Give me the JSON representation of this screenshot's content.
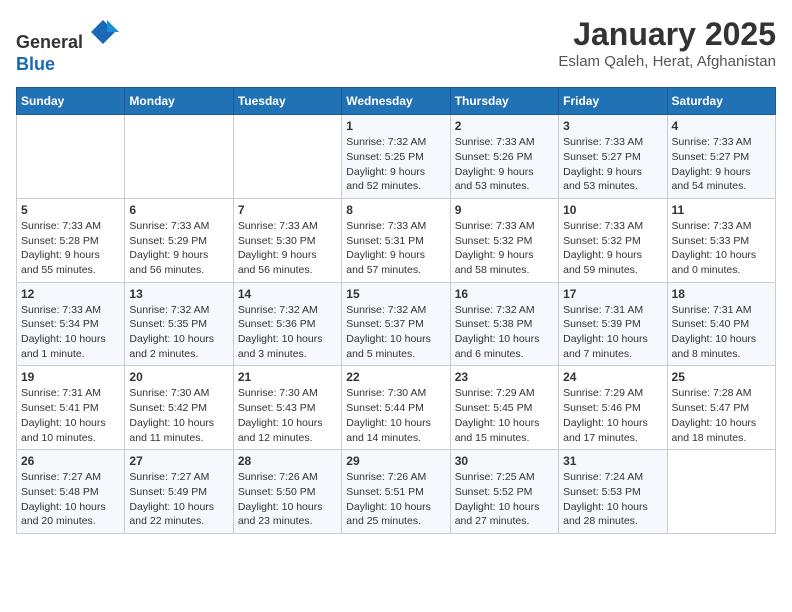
{
  "header": {
    "logo_line1": "General",
    "logo_line2": "Blue",
    "title": "January 2025",
    "subtitle": "Eslam Qaleh, Herat, Afghanistan"
  },
  "weekdays": [
    "Sunday",
    "Monday",
    "Tuesday",
    "Wednesday",
    "Thursday",
    "Friday",
    "Saturday"
  ],
  "weeks": [
    [
      {
        "day": "",
        "info": ""
      },
      {
        "day": "",
        "info": ""
      },
      {
        "day": "",
        "info": ""
      },
      {
        "day": "1",
        "info": "Sunrise: 7:32 AM\nSunset: 5:25 PM\nDaylight: 9 hours\nand 52 minutes."
      },
      {
        "day": "2",
        "info": "Sunrise: 7:33 AM\nSunset: 5:26 PM\nDaylight: 9 hours\nand 53 minutes."
      },
      {
        "day": "3",
        "info": "Sunrise: 7:33 AM\nSunset: 5:27 PM\nDaylight: 9 hours\nand 53 minutes."
      },
      {
        "day": "4",
        "info": "Sunrise: 7:33 AM\nSunset: 5:27 PM\nDaylight: 9 hours\nand 54 minutes."
      }
    ],
    [
      {
        "day": "5",
        "info": "Sunrise: 7:33 AM\nSunset: 5:28 PM\nDaylight: 9 hours\nand 55 minutes."
      },
      {
        "day": "6",
        "info": "Sunrise: 7:33 AM\nSunset: 5:29 PM\nDaylight: 9 hours\nand 56 minutes."
      },
      {
        "day": "7",
        "info": "Sunrise: 7:33 AM\nSunset: 5:30 PM\nDaylight: 9 hours\nand 56 minutes."
      },
      {
        "day": "8",
        "info": "Sunrise: 7:33 AM\nSunset: 5:31 PM\nDaylight: 9 hours\nand 57 minutes."
      },
      {
        "day": "9",
        "info": "Sunrise: 7:33 AM\nSunset: 5:32 PM\nDaylight: 9 hours\nand 58 minutes."
      },
      {
        "day": "10",
        "info": "Sunrise: 7:33 AM\nSunset: 5:32 PM\nDaylight: 9 hours\nand 59 minutes."
      },
      {
        "day": "11",
        "info": "Sunrise: 7:33 AM\nSunset: 5:33 PM\nDaylight: 10 hours\nand 0 minutes."
      }
    ],
    [
      {
        "day": "12",
        "info": "Sunrise: 7:33 AM\nSunset: 5:34 PM\nDaylight: 10 hours\nand 1 minute."
      },
      {
        "day": "13",
        "info": "Sunrise: 7:32 AM\nSunset: 5:35 PM\nDaylight: 10 hours\nand 2 minutes."
      },
      {
        "day": "14",
        "info": "Sunrise: 7:32 AM\nSunset: 5:36 PM\nDaylight: 10 hours\nand 3 minutes."
      },
      {
        "day": "15",
        "info": "Sunrise: 7:32 AM\nSunset: 5:37 PM\nDaylight: 10 hours\nand 5 minutes."
      },
      {
        "day": "16",
        "info": "Sunrise: 7:32 AM\nSunset: 5:38 PM\nDaylight: 10 hours\nand 6 minutes."
      },
      {
        "day": "17",
        "info": "Sunrise: 7:31 AM\nSunset: 5:39 PM\nDaylight: 10 hours\nand 7 minutes."
      },
      {
        "day": "18",
        "info": "Sunrise: 7:31 AM\nSunset: 5:40 PM\nDaylight: 10 hours\nand 8 minutes."
      }
    ],
    [
      {
        "day": "19",
        "info": "Sunrise: 7:31 AM\nSunset: 5:41 PM\nDaylight: 10 hours\nand 10 minutes."
      },
      {
        "day": "20",
        "info": "Sunrise: 7:30 AM\nSunset: 5:42 PM\nDaylight: 10 hours\nand 11 minutes."
      },
      {
        "day": "21",
        "info": "Sunrise: 7:30 AM\nSunset: 5:43 PM\nDaylight: 10 hours\nand 12 minutes."
      },
      {
        "day": "22",
        "info": "Sunrise: 7:30 AM\nSunset: 5:44 PM\nDaylight: 10 hours\nand 14 minutes."
      },
      {
        "day": "23",
        "info": "Sunrise: 7:29 AM\nSunset: 5:45 PM\nDaylight: 10 hours\nand 15 minutes."
      },
      {
        "day": "24",
        "info": "Sunrise: 7:29 AM\nSunset: 5:46 PM\nDaylight: 10 hours\nand 17 minutes."
      },
      {
        "day": "25",
        "info": "Sunrise: 7:28 AM\nSunset: 5:47 PM\nDaylight: 10 hours\nand 18 minutes."
      }
    ],
    [
      {
        "day": "26",
        "info": "Sunrise: 7:27 AM\nSunset: 5:48 PM\nDaylight: 10 hours\nand 20 minutes."
      },
      {
        "day": "27",
        "info": "Sunrise: 7:27 AM\nSunset: 5:49 PM\nDaylight: 10 hours\nand 22 minutes."
      },
      {
        "day": "28",
        "info": "Sunrise: 7:26 AM\nSunset: 5:50 PM\nDaylight: 10 hours\nand 23 minutes."
      },
      {
        "day": "29",
        "info": "Sunrise: 7:26 AM\nSunset: 5:51 PM\nDaylight: 10 hours\nand 25 minutes."
      },
      {
        "day": "30",
        "info": "Sunrise: 7:25 AM\nSunset: 5:52 PM\nDaylight: 10 hours\nand 27 minutes."
      },
      {
        "day": "31",
        "info": "Sunrise: 7:24 AM\nSunset: 5:53 PM\nDaylight: 10 hours\nand 28 minutes."
      },
      {
        "day": "",
        "info": ""
      }
    ]
  ]
}
